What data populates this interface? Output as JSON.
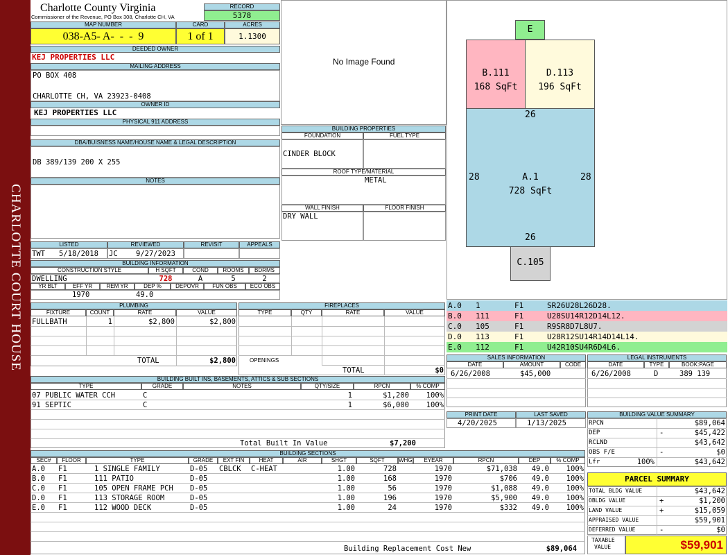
{
  "sidebar_title": "CHARLOTTE COURT HOUSE",
  "header": {
    "county": "Charlotte County Virginia",
    "address": "Commissioner of the Revenue, PO Box 308, Charlotte CH, VA",
    "record_label": "RECORD",
    "record": "5378",
    "map_label": "MAP NUMBER",
    "map": "038-A5- A-  -  -  9",
    "card_label": "CARD",
    "card": "1 of 1",
    "acres_label": "ACRES",
    "acres": "1.1300"
  },
  "owner": {
    "deeded_label": "DEEDED OWNER",
    "deeded": "KEJ PROPERTIES LLC",
    "mailing_label": "MAILING ADDRESS",
    "mail1": "PO BOX 408",
    "mail2": "CHARLOTTE CH, VA 23923-0408",
    "id_label": "OWNER ID",
    "id": "KEJ PROPERTIES LLC",
    "phys_label": "PHYSICAL 911 ADDRESS",
    "phys": ""
  },
  "dba": {
    "label": "DBA/BUISNESS NAME/HOUSE NAME & LEGAL DESCRIPTION",
    "value": "DB 389/139 200 X 255"
  },
  "notes": {
    "label": "NOTES",
    "value": ""
  },
  "image": {
    "no_image": "No Image Found"
  },
  "bldg_props": {
    "label": "BUILDING PROPERTIES",
    "foundation_label": "FOUNDATION",
    "foundation": "CINDER BLOCK",
    "fuel_label": "FUEL TYPE",
    "fuel": "",
    "roof_label": "ROOF TYPE/MATERIAL",
    "roof": "METAL",
    "wall_label": "WALL FINISH",
    "wall": "DRY WALL",
    "floor_label": "FLOOR FINISH",
    "floor": ""
  },
  "listing": {
    "listed_label": "LISTED",
    "reviewed_label": "REVIEWED",
    "revisit_label": "REVISIT",
    "appeals_label": "APPEALS",
    "listed_by": "TWT",
    "listed_date": "5/18/2018",
    "reviewed_by": "JC",
    "reviewed_date": "9/27/2023"
  },
  "bldg_info": {
    "label": "BUILDING INFORMATION",
    "style_label": "CONSTRUCTION STYLE",
    "hsqft_label": "H SQFT",
    "cond_label": "COND",
    "rooms_label": "ROOMS",
    "bdrms_label": "BDRMS",
    "style": "DWELLING",
    "hsqft": "728",
    "cond": "A",
    "rooms": "5",
    "bdrms": "2",
    "yrblt_label": "YR BLT",
    "effyr_label": "EFF YR",
    "remyr_label": "REM YR",
    "dep_label": "DEP %",
    "depovr_label": "DEPOVR",
    "funobs_label": "FUN OBS",
    "ecoobs_label": "ECO OBS",
    "effyr": "1970",
    "dep": "49.0"
  },
  "plumbing": {
    "label": "PLUMBING",
    "cols": [
      "FIXTURE",
      "COUNT",
      "RATE",
      "VALUE"
    ],
    "rows": [
      [
        "FULLBATH",
        "1",
        "$2,800",
        "$2,800"
      ]
    ],
    "total_label": "TOTAL",
    "total": "$2,800"
  },
  "fireplaces": {
    "label": "FIREPLACES",
    "cols": [
      "TYPE",
      "QTY",
      "RATE",
      "VALUE"
    ],
    "openings_label": "OPENINGS",
    "total_label": "TOTAL",
    "total": "$0"
  },
  "builtins": {
    "label": "BUILDING BUILT INS, BASEMENTS, ATTICS & SUB SECTIONS",
    "cols": [
      "TYPE",
      "GRADE",
      "NOTES",
      "QTY/SIZE",
      "RPCN",
      "% COMP"
    ],
    "rows": [
      [
        "07 PUBLIC WATER CCH",
        "C",
        "",
        "1",
        "$1,200",
        "100%"
      ],
      [
        "91 SEPTIC",
        "C",
        "",
        "1",
        "$6,000",
        "100%"
      ]
    ],
    "total_label": "Total Built In Value",
    "total": "$7,200"
  },
  "sketch": {
    "e": "E",
    "b": "B.111",
    "b_area": "168 SqFt",
    "d": "D.113",
    "d_area": "196 SqFt",
    "a": "A.1",
    "a_area": "728 SqFt",
    "c": "C.105",
    "top": "26",
    "bottom": "26",
    "left": "28",
    "right": "28",
    "legend": [
      {
        "sec": "A.0",
        "n": "1",
        "f": "F1",
        "path": "SR26U28L26D28.",
        "color": "#add8e6"
      },
      {
        "sec": "B.0",
        "n": "111",
        "f": "F1",
        "path": "U28SU14R12D14L12.",
        "color": "#ffb6c1"
      },
      {
        "sec": "C.0",
        "n": "105",
        "f": "F1",
        "path": "R9SR8D7L8U7.",
        "color": "#d3d3d3"
      },
      {
        "sec": "D.0",
        "n": "113",
        "f": "F1",
        "path": "U28R12SU14R14D14L14.",
        "color": "#fffadc"
      },
      {
        "sec": "E.0",
        "n": "112",
        "f": "F1",
        "path": "U42R10SU4R6D4L6.",
        "color": "#90ee90"
      }
    ]
  },
  "sales": {
    "label": "SALES INFORMATION",
    "cols": [
      "DATE",
      "AMOUNT",
      "CODE"
    ],
    "rows": [
      [
        "6/26/2008",
        "$45,000",
        ""
      ]
    ]
  },
  "legal": {
    "label": "LEGAL INSTRUMENTS",
    "cols": [
      "DATE",
      "TYPE",
      "BOOK:PAGE"
    ],
    "rows": [
      [
        "6/26/2008",
        "D",
        "389 139"
      ]
    ]
  },
  "print": {
    "print_label": "PRINT DATE",
    "saved_label": "LAST SAVED",
    "print_date": "4/20/2025",
    "saved": "1/13/2025"
  },
  "value_summary": {
    "label": "BUILDING VALUE SUMMARY",
    "rows": [
      [
        "RPCN",
        "",
        "$89,064"
      ],
      [
        "DEP",
        "-",
        "$45,422"
      ],
      [
        "RCLND",
        "",
        "$43,642"
      ],
      [
        "OBS F/E",
        "-",
        "$0"
      ],
      [
        "Lfr",
        "100%",
        "$43,642"
      ]
    ]
  },
  "parcel": {
    "label": "PARCEL SUMMARY",
    "rows": [
      [
        "TOTAL BLDG VALUE",
        "",
        "$43,642"
      ],
      [
        "OBLDG VALUE",
        "+",
        "$1,200"
      ],
      [
        "LAND VALUE",
        "+",
        "$15,059"
      ],
      [
        "APPRAISED VALUE",
        "",
        "$59,901"
      ],
      [
        "DEFERRED VALUE",
        "-",
        "$0"
      ]
    ],
    "taxable_label1": "TAXABLE",
    "taxable_label2": "VALUE",
    "taxable": "$59,901"
  },
  "sections": {
    "label": "BUILDING SECTIONS",
    "cols": [
      "SEC#",
      "FLOOR",
      "TYPE",
      "GRADE",
      "EXT FIN",
      "HEAT",
      "AIR",
      "SHGT",
      "SQFT",
      "WHGT",
      "EYEAR",
      "RPCN",
      "DEP",
      "% COMP"
    ],
    "rows": [
      [
        "A.0",
        "F1",
        "1 SINGLE FAMILY",
        "D-05",
        "CBLCK",
        "C-HEAT",
        "",
        "1.00",
        "728",
        "",
        "1970",
        "$71,038",
        "49.0",
        "100%"
      ],
      [
        "B.0",
        "F1",
        "111 PATIO",
        "D-05",
        "",
        "",
        "",
        "1.00",
        "168",
        "",
        "1970",
        "$706",
        "49.0",
        "100%"
      ],
      [
        "C.0",
        "F1",
        "105 OPEN FRAME PCH",
        "D-05",
        "",
        "",
        "",
        "1.00",
        "56",
        "",
        "1970",
        "$1,088",
        "49.0",
        "100%"
      ],
      [
        "D.0",
        "F1",
        "113 STORAGE ROOM",
        "D-05",
        "",
        "",
        "",
        "1.00",
        "196",
        "",
        "1970",
        "$5,900",
        "49.0",
        "100%"
      ],
      [
        "E.0",
        "F1",
        "112 WOOD DECK",
        "D-05",
        "",
        "",
        "",
        "1.00",
        "24",
        "",
        "1970",
        "$332",
        "49.0",
        "100%"
      ]
    ],
    "total_label": "Building Replacement Cost New",
    "total": "$89,064"
  }
}
